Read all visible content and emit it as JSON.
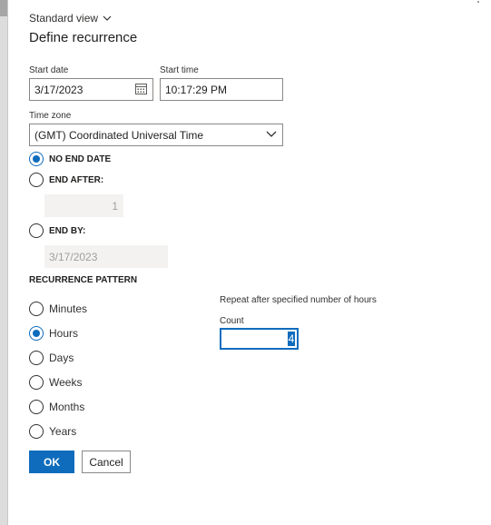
{
  "header": {
    "view_selector": "Standard view",
    "title": "Define recurrence"
  },
  "start_date": {
    "label": "Start date",
    "value": "3/17/2023"
  },
  "start_time": {
    "label": "Start time",
    "value": "10:17:29 PM"
  },
  "time_zone": {
    "label": "Time zone",
    "value": "(GMT) Coordinated Universal Time"
  },
  "end_options": {
    "no_end_date": {
      "label": "NO END DATE",
      "checked": true
    },
    "end_after": {
      "label": "END AFTER:",
      "value": "1",
      "checked": false
    },
    "end_by": {
      "label": "END BY:",
      "value": "3/17/2023",
      "checked": false
    }
  },
  "recurrence_pattern": {
    "heading": "RECURRENCE PATTERN",
    "options": [
      {
        "label": "Minutes",
        "checked": false
      },
      {
        "label": "Hours",
        "checked": true
      },
      {
        "label": "Days",
        "checked": false
      },
      {
        "label": "Weeks",
        "checked": false
      },
      {
        "label": "Months",
        "checked": false
      },
      {
        "label": "Years",
        "checked": false
      }
    ],
    "hint": "Repeat after specified number of hours",
    "count_label": "Count",
    "count_value": "4"
  },
  "buttons": {
    "ok": "OK",
    "cancel": "Cancel"
  },
  "colors": {
    "accent": "#0f6cbd",
    "disabled_bg": "#f3f2f1",
    "border": "#8a8886"
  }
}
